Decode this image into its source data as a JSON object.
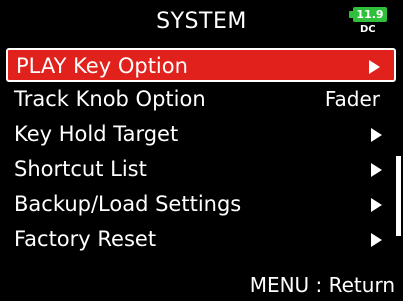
{
  "header": {
    "title": "SYSTEM",
    "battery": {
      "value": "11.9",
      "source": "DC",
      "color": "#2fbf3a"
    }
  },
  "menu": {
    "items": [
      {
        "label": "PLAY Key Option",
        "value": "",
        "icon": "chevron-right-icon",
        "selected": true
      },
      {
        "label": "Track Knob Option",
        "value": "Fader",
        "icon": "",
        "selected": false
      },
      {
        "label": "Key Hold Target",
        "value": "",
        "icon": "chevron-right-icon",
        "selected": false
      },
      {
        "label": "Shortcut List",
        "value": "",
        "icon": "chevron-right-icon",
        "selected": false
      },
      {
        "label": "Backup/Load Settings",
        "value": "",
        "icon": "chevron-right-icon",
        "selected": false
      },
      {
        "label": "Factory Reset",
        "value": "",
        "icon": "chevron-right-icon",
        "selected": false
      }
    ],
    "selection_color": "#e0211c"
  },
  "footer": {
    "hint": "MENU : Return"
  }
}
